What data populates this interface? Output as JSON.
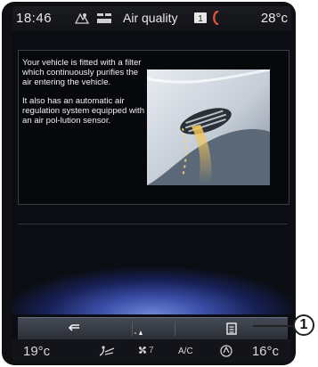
{
  "status_bar": {
    "time": "18:46",
    "title": "Air quality",
    "outside_temp": "28°c",
    "icons": [
      "navigation-icon",
      "media-icon",
      "message-icon",
      "phone-icon"
    ]
  },
  "content": {
    "paragraph1": "Your vehicle is fitted with a filter which continuously purifies the air entering the vehicle.",
    "paragraph2": "It also has an automatic air regulation system equipped with an air pol-lution sensor."
  },
  "action_bar": {
    "buttons": [
      "back-icon",
      "menu-icon"
    ]
  },
  "climate": {
    "left_temp": "19°c",
    "fan_level": "7",
    "ac_label": "A/C",
    "right_temp": "16°c"
  },
  "callout": {
    "label": "1"
  },
  "colors": {
    "screen_bg": "#0b0d12",
    "glow": "#3b4fa8",
    "text": "#f0f0f0"
  }
}
